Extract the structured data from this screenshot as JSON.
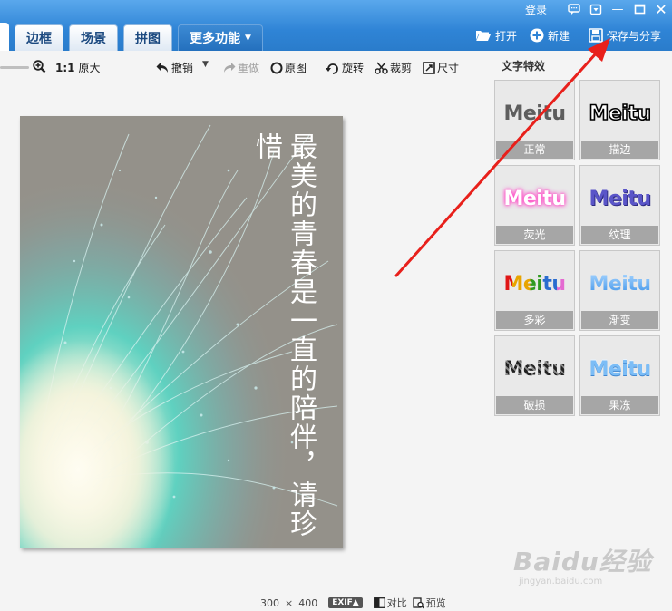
{
  "window": {
    "login_label": "登录",
    "minimize": "—",
    "close": "✕"
  },
  "tabs": [
    {
      "label": "边框"
    },
    {
      "label": "场景"
    },
    {
      "label": "拼图"
    },
    {
      "label": "更多功能"
    }
  ],
  "actions": {
    "open": "打开",
    "new": "新建",
    "save_share": "保存与分享"
  },
  "toolbar": {
    "ratio": "1:1",
    "original_size": "原大",
    "undo": "撤销",
    "redo": "重做",
    "original": "原图",
    "rotate": "旋转",
    "crop": "裁剪",
    "size": "尺寸"
  },
  "canvas": {
    "poster_text": "最美的青春是一直的陪伴，请珍惜"
  },
  "effects_panel": {
    "title": "文字特效",
    "items": [
      {
        "word": "Meitu",
        "label": "正常",
        "style": "normal"
      },
      {
        "word": "Meitu",
        "label": "描边",
        "style": "stroke"
      },
      {
        "word": "Meitu",
        "label": "荧光",
        "style": "glow"
      },
      {
        "word": "Meitu",
        "label": "纹理",
        "style": "texture"
      },
      {
        "word": "Meitu",
        "label": "多彩",
        "style": "multi"
      },
      {
        "word": "Meitu",
        "label": "渐变",
        "style": "grad"
      },
      {
        "word": "Meitu",
        "label": "破损",
        "style": "broken"
      },
      {
        "word": "Meitu",
        "label": "果冻",
        "style": "jelly"
      }
    ]
  },
  "status": {
    "width": "300",
    "times": "×",
    "height": "400",
    "exif": "EXIF▲",
    "compare": "对比",
    "preview": "预览"
  },
  "watermark": {
    "main": "Baidu经验",
    "sub": "jingyan.baidu.com"
  },
  "colors": {
    "accent_blue": "#2f84d6",
    "annotation_red": "#e8201b"
  }
}
